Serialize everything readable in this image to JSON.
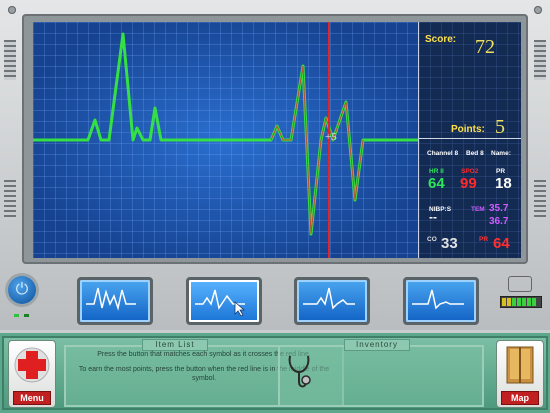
{
  "monitor": {
    "score_label": "Score:",
    "score_value": "72",
    "points_label": "Points:",
    "points_value": "5",
    "channel_label": "Channel 8",
    "bed_label": "Bed 8",
    "name_label": "Name:",
    "hr_label": "HR II",
    "hr_value": "64",
    "spo2_label": "SPO2",
    "spo2_value": "99",
    "pr_label": "PR",
    "pr_value": "18",
    "nibp_label": "NIBP:S",
    "nibp_value": "--",
    "tem_label": "TEM",
    "tem_value_1": "35.7",
    "tem_value_2": "36.7",
    "co2_label": "CO",
    "co2_value": "33",
    "pr2_label": "PR",
    "pr2_value": "64",
    "floating_points": "+5"
  },
  "colors": {
    "ecg_line": "#34e043",
    "marker_line": "#e0262a",
    "hr_color": "#2ee65a",
    "spo2_color": "#ff2a2a",
    "pr_color": "#ffffff",
    "tem_color": "#d05bff",
    "co2_color": "#e0e0e0",
    "pr2_color": "#ff3030",
    "label_color": "#ffe24a"
  },
  "buttons": {
    "menu_label": "Menu",
    "map_label": "Map"
  },
  "item_list": {
    "title": "Item List",
    "instruction_1": "Press the button that matches each symbol as it crosses the red line.",
    "instruction_2": "To earn the most points, press the button when the red line is in the middle of the symbol."
  },
  "inventory": {
    "title": "Inventory",
    "items": [
      "stethoscope-icon"
    ]
  },
  "battery_levels": [
    "#d8c020",
    "#d8c020",
    "#3bd040",
    "#3bd040",
    "#3bd040",
    "#3bd040",
    "#3bd040"
  ]
}
